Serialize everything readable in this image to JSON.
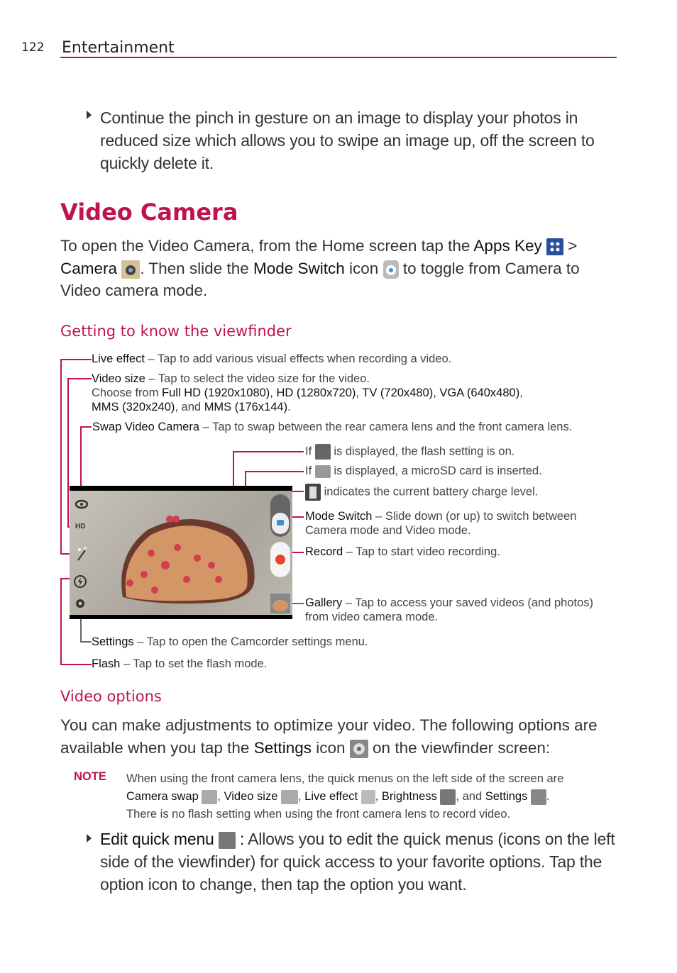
{
  "header": {
    "page_number": "122",
    "section": "Entertainment"
  },
  "intro_bullet": "Continue the pinch in gesture on an image to display your photos in reduced size which allows you to swipe an image up, off the screen to quickly delete it.",
  "title": "Video Camera",
  "open_instructions": {
    "p1": "To open the Video Camera, from the Home screen tap the ",
    "apps_key": "Apps Key",
    "gt": " >",
    "camera": "Camera",
    "p2": ". Then slide the ",
    "mode_switch": "Mode Switch",
    "p3": " icon ",
    "p4": " to toggle from Camera to Video camera mode."
  },
  "viewfinder_heading": "Getting to know the viewfinder",
  "annotations": {
    "live_effect": {
      "term": "Live effect",
      "desc": " – Tap to add various visual effects when recording a video."
    },
    "video_size": {
      "term": "Video size",
      "desc": " – Tap to select the video size for the video.",
      "choose": "Choose from ",
      "sizes": [
        "Full HD (1920x1080)",
        "HD (1280x720)",
        "TV (720x480)",
        "VGA (640x480)",
        "MMS (320x240)",
        "MMS (176x144)"
      ],
      "and": ", and "
    },
    "swap": {
      "term": "Swap Video Camera",
      "desc": " – Tap to swap between the rear camera lens and the front camera lens."
    },
    "flash_on": {
      "pre": "If ",
      "post": " is displayed, the flash setting is on."
    },
    "sd": {
      "pre": "If ",
      "post": " is displayed, a microSD card is inserted."
    },
    "battery": {
      "post": " indicates the current battery charge level."
    },
    "mode_switch": {
      "term": "Mode Switch",
      "desc": " – Slide down (or up) to switch between",
      "desc2": "Camera mode and Video mode."
    },
    "record": {
      "term": "Record",
      "desc": " – Tap to start video recording."
    },
    "gallery": {
      "term": "Gallery",
      "desc": " – Tap to access your saved videos (and photos)",
      "desc2": "from video camera mode."
    },
    "settings": {
      "term": "Settings",
      "desc": " – Tap to open the Camcorder settings menu."
    },
    "flash": {
      "term": "Flash",
      "desc": " – Tap to set the flash mode."
    }
  },
  "viewfinder_overlay": {
    "hd_label": "HD"
  },
  "video_options": {
    "heading": "Video options",
    "p1": "You can make adjustments to optimize your video. The following options are available when you tap the ",
    "settings": "Settings",
    "p2": " icon ",
    "p3": " on the viewfinder screen:"
  },
  "note": {
    "label": "NOTE",
    "line1": "When using the front camera lens, the quick menus on the left side of the screen are",
    "items": [
      "Camera swap",
      "Video size",
      "Live effect",
      "Brightness",
      "Settings"
    ],
    "and": ", and ",
    "line3": "There is no flash setting when using the front camera lens to record video."
  },
  "edit_quick_menu": {
    "term": "Edit quick menu",
    "colon": " :",
    "desc": " Allows you to edit the quick menus (icons on the left side of the viewfinder) for quick access to your favorite options. Tap the option icon to change, then tap the option you want."
  }
}
